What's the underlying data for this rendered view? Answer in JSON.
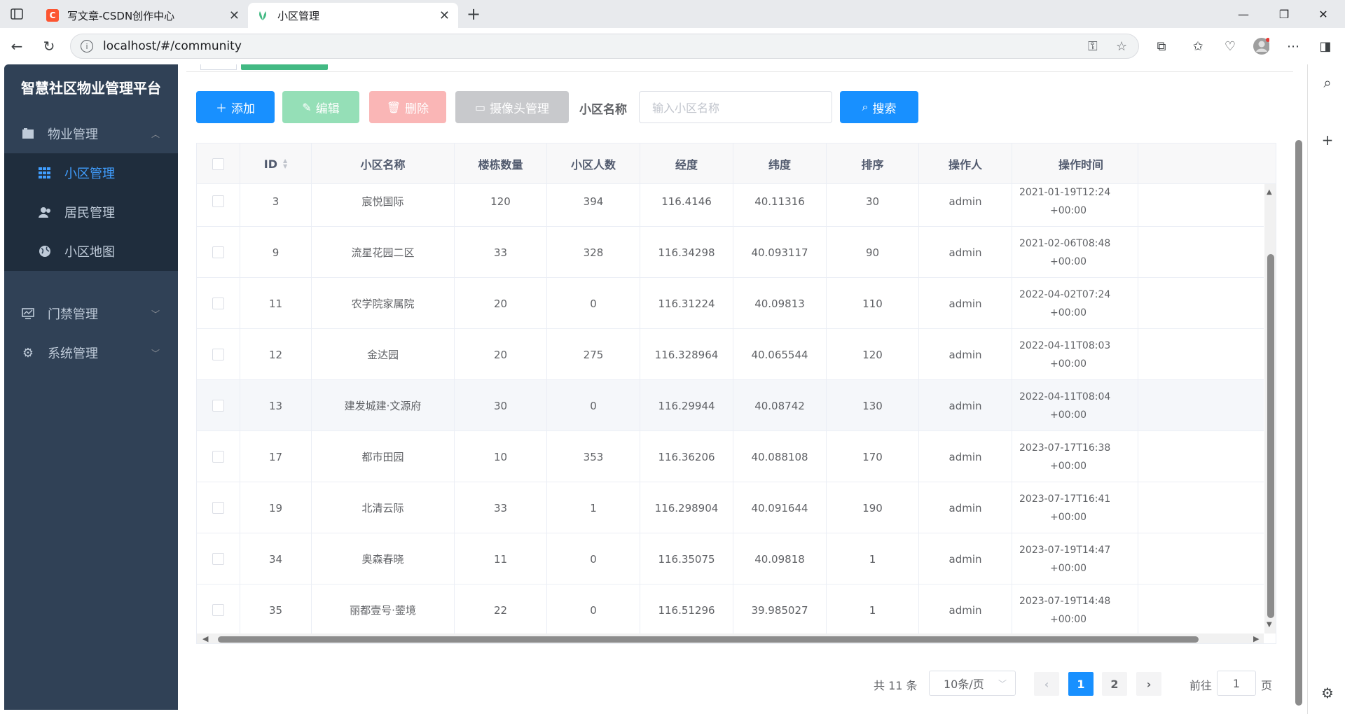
{
  "browser": {
    "tabs": [
      {
        "title": "写文章-CSDN创作中心",
        "favicon": "csdn-icon",
        "color": "#fc5531"
      },
      {
        "title": "小区管理",
        "favicon": "vue-leaf-icon",
        "color": "#42b983"
      }
    ],
    "url": "localhost/#/community"
  },
  "app": {
    "brand": "智慧社区物业管理平台",
    "menu": [
      {
        "label": "物业管理",
        "icon": "building-icon",
        "expanded": true
      },
      {
        "label": "门禁管理",
        "icon": "monitor-icon",
        "expanded": false
      },
      {
        "label": "系统管理",
        "icon": "gear-icon",
        "expanded": false
      }
    ],
    "submenu": [
      {
        "label": "小区管理",
        "icon": "grid-icon",
        "active": true
      },
      {
        "label": "居民管理",
        "icon": "user-icon",
        "active": false
      },
      {
        "label": "小区地图",
        "icon": "globe-icon",
        "active": false
      }
    ]
  },
  "toolbar": {
    "add": "添加",
    "edit": "编辑",
    "delete": "删除",
    "camera": "摄像头管理",
    "search_label": "小区名称",
    "search_placeholder": "输入小区名称",
    "search": "搜索"
  },
  "table": {
    "columns": [
      "ID",
      "小区名称",
      "楼栋数量",
      "小区人数",
      "经度",
      "纬度",
      "排序",
      "操作人",
      "操作时间"
    ],
    "rows": [
      {
        "id": "3",
        "name": "宸悦国际",
        "buildings": "120",
        "people": "394",
        "lng": "116.4146",
        "lat": "40.11316",
        "sort": "30",
        "op": "admin",
        "time1": "2021-01-19T12:24",
        "time2": "+00:00"
      },
      {
        "id": "9",
        "name": "流星花园二区",
        "buildings": "33",
        "people": "328",
        "lng": "116.34298",
        "lat": "40.093117",
        "sort": "90",
        "op": "admin",
        "time1": "2021-02-06T08:48",
        "time2": "+00:00"
      },
      {
        "id": "11",
        "name": "农学院家属院",
        "buildings": "20",
        "people": "0",
        "lng": "116.31224",
        "lat": "40.09813",
        "sort": "110",
        "op": "admin",
        "time1": "2022-04-02T07:24",
        "time2": "+00:00"
      },
      {
        "id": "12",
        "name": "金达园",
        "buildings": "20",
        "people": "275",
        "lng": "116.328964",
        "lat": "40.065544",
        "sort": "120",
        "op": "admin",
        "time1": "2022-04-11T08:03",
        "time2": "+00:00"
      },
      {
        "id": "13",
        "name": "建发城建·文源府",
        "buildings": "30",
        "people": "0",
        "lng": "116.29944",
        "lat": "40.08742",
        "sort": "130",
        "op": "admin",
        "time1": "2022-04-11T08:04",
        "time2": "+00:00"
      },
      {
        "id": "17",
        "name": "都市田园",
        "buildings": "10",
        "people": "353",
        "lng": "116.36206",
        "lat": "40.088108",
        "sort": "170",
        "op": "admin",
        "time1": "2023-07-17T16:38",
        "time2": "+00:00"
      },
      {
        "id": "19",
        "name": "北清云际",
        "buildings": "33",
        "people": "1",
        "lng": "116.298904",
        "lat": "40.091644",
        "sort": "190",
        "op": "admin",
        "time1": "2023-07-17T16:41",
        "time2": "+00:00"
      },
      {
        "id": "34",
        "name": "奥森春晓",
        "buildings": "11",
        "people": "0",
        "lng": "116.35075",
        "lat": "40.09818",
        "sort": "1",
        "op": "admin",
        "time1": "2023-07-19T14:47",
        "time2": "+00:00"
      },
      {
        "id": "35",
        "name": "丽都壹号·蓥境",
        "buildings": "22",
        "people": "0",
        "lng": "116.51296",
        "lat": "39.985027",
        "sort": "1",
        "op": "admin",
        "time1": "2023-07-19T14:48",
        "time2": "+00:00"
      }
    ]
  },
  "pagination": {
    "total": "共 11 条",
    "page_size": "10条/页",
    "pages": [
      "1",
      "2"
    ],
    "goto_prefix": "前往",
    "goto_value": "1",
    "goto_suffix": "页"
  }
}
